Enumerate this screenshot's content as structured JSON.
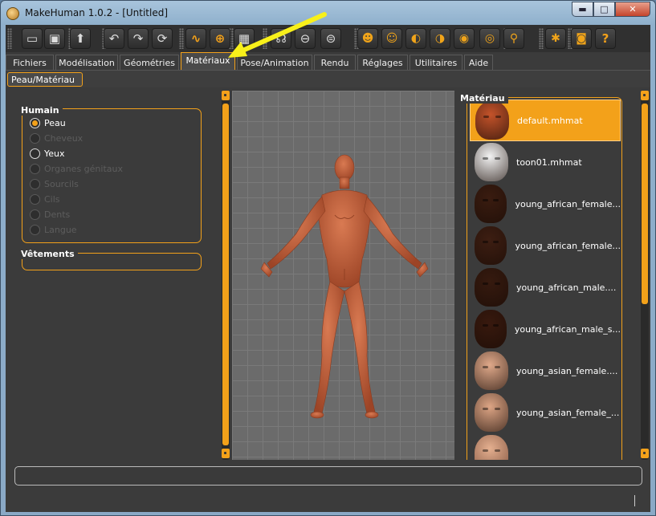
{
  "window": {
    "title": "MakeHuman 1.0.2 - [Untitled]"
  },
  "titlebar_buttons": {
    "minimize": "▬",
    "maximize": "□",
    "close": "✕"
  },
  "toolbar": {
    "buttons": [
      {
        "name": "new-icon",
        "glyph": "▭"
      },
      {
        "name": "save-icon",
        "glyph": "▣"
      },
      {
        "name": "export-icon",
        "glyph": "⬆"
      },
      {
        "name": "undo-icon",
        "glyph": "↶"
      },
      {
        "name": "redo-icon",
        "glyph": "↷"
      },
      {
        "name": "reset-icon",
        "glyph": "⟳"
      },
      {
        "name": "smooth-icon",
        "glyph": "∿"
      },
      {
        "name": "wireframe-icon",
        "glyph": "⊕"
      },
      {
        "name": "background-icon",
        "glyph": "▦"
      },
      {
        "name": "pose-icon",
        "glyph": "☊"
      },
      {
        "name": "view-left-icon",
        "glyph": "⊖"
      },
      {
        "name": "view-right-icon",
        "glyph": "⊜"
      },
      {
        "name": "front-view-icon",
        "glyph": "☻"
      },
      {
        "name": "back-view-icon",
        "glyph": "☺"
      },
      {
        "name": "left-view-icon",
        "glyph": "◐"
      },
      {
        "name": "right-view-icon",
        "glyph": "◑"
      },
      {
        "name": "top-view-icon",
        "glyph": "◉"
      },
      {
        "name": "bottom-view-icon",
        "glyph": "◎"
      },
      {
        "name": "symmetry-icon",
        "glyph": "⚲"
      },
      {
        "name": "skeleton-icon",
        "glyph": "✱"
      },
      {
        "name": "camera-icon",
        "glyph": "◙"
      },
      {
        "name": "help-icon",
        "glyph": "?"
      }
    ]
  },
  "tabs": [
    {
      "label": "Fichiers"
    },
    {
      "label": "Modélisation"
    },
    {
      "label": "Géométries"
    },
    {
      "label": "Matériaux",
      "active": true
    },
    {
      "label": "Pose/Animation"
    },
    {
      "label": "Rendu"
    },
    {
      "label": "Réglages"
    },
    {
      "label": "Utilitaires"
    },
    {
      "label": "Aide"
    }
  ],
  "subtab": {
    "label": "Peau/Matériau"
  },
  "left": {
    "human_title": "Humain",
    "human_options": [
      {
        "label": "Peau",
        "checked": true,
        "enabled": true
      },
      {
        "label": "Cheveux",
        "checked": false,
        "enabled": false
      },
      {
        "label": "Yeux",
        "checked": false,
        "enabled": true
      },
      {
        "label": "Organes génitaux",
        "checked": false,
        "enabled": false
      },
      {
        "label": "Sourcils",
        "checked": false,
        "enabled": false
      },
      {
        "label": "Cils",
        "checked": false,
        "enabled": false
      },
      {
        "label": "Dents",
        "checked": false,
        "enabled": false
      },
      {
        "label": "Langue",
        "checked": false,
        "enabled": false
      }
    ],
    "clothes_title": "Vêtements"
  },
  "right": {
    "title": "Matériau",
    "materials": [
      {
        "label": "default.mhmat",
        "color": "#c4532a",
        "selected": true
      },
      {
        "label": "toon01.mhmat",
        "color": "#f2f2f2",
        "selected": false
      },
      {
        "label": "young_african_female...",
        "color": "#3a1c10",
        "selected": false
      },
      {
        "label": "young_african_female...",
        "color": "#3d1e12",
        "selected": false
      },
      {
        "label": "young_african_male....",
        "color": "#361a0f",
        "selected": false
      },
      {
        "label": "young_african_male_s...",
        "color": "#38190e",
        "selected": false
      },
      {
        "label": "young_asian_female....",
        "color": "#e0a98a",
        "selected": false
      },
      {
        "label": "young_asian_female_...",
        "color": "#dda585",
        "selected": false
      }
    ]
  },
  "colors": {
    "accent": "#f3a11a",
    "skin": "#c96a45",
    "annotation_arrow": "#f8f01a"
  }
}
